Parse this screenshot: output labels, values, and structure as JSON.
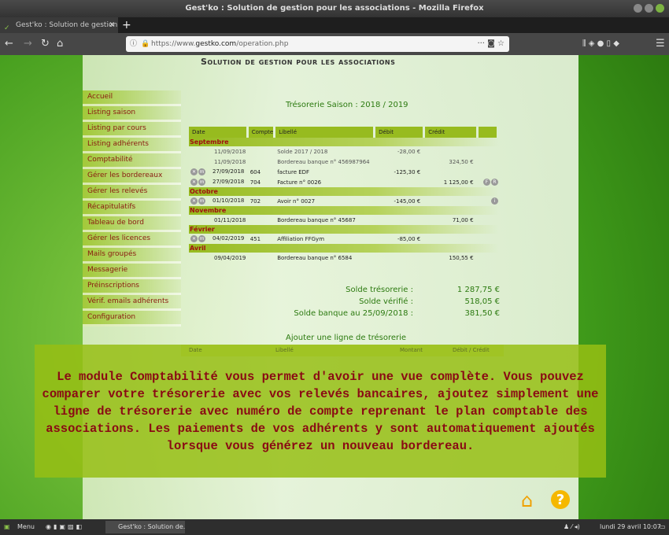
{
  "window": {
    "title": "Gest'ko : Solution de gestion pour les associations - Mozilla Firefox"
  },
  "browser": {
    "tab_title": "Gest'ko : Solution de gestion p",
    "url_prefix": "https://www.",
    "url_domain": "gestko.com",
    "url_path": "/operation.php"
  },
  "header": {
    "slogan": "Solution de gestion pour les associations"
  },
  "sidebar": {
    "items": [
      {
        "label": "Accueil"
      },
      {
        "label": "Listing saison"
      },
      {
        "label": "Listing par cours"
      },
      {
        "label": "Listing adhérents"
      },
      {
        "label": "Comptabilité"
      },
      {
        "label": "Gérer les bordereaux"
      },
      {
        "label": "Gérer les relevés"
      },
      {
        "label": "Récapitulatifs"
      },
      {
        "label": "Tableau de bord"
      },
      {
        "label": "Gérer les licences"
      },
      {
        "label": "Mails groupés"
      },
      {
        "label": "Messagerie"
      },
      {
        "label": "Préinscriptions"
      },
      {
        "label": "Vérif. emails adhérents"
      },
      {
        "label": "Configuration"
      }
    ]
  },
  "main": {
    "title": "Trésorerie Saison : 2018 / 2019",
    "columns": [
      "Date",
      "Compte",
      "Libellé",
      "Débit",
      "Crédit",
      ""
    ],
    "groups": [
      {
        "month": "Septembre",
        "rows": [
          {
            "date": "11/09/2018",
            "compte": "",
            "libelle": "Solde 2017 / 2018",
            "debit": "-28,00 €",
            "credit": "",
            "editable": false,
            "muted": true,
            "tags": []
          },
          {
            "date": "11/09/2018",
            "compte": "",
            "libelle": "Bordereau banque n° 456987964",
            "debit": "",
            "credit": "324,50 €",
            "editable": false,
            "muted": true,
            "tags": []
          },
          {
            "date": "27/09/2018",
            "compte": "604",
            "libelle": "facture EDF",
            "debit": "-125,30 €",
            "credit": "",
            "editable": true,
            "tags": []
          },
          {
            "date": "27/09/2018",
            "compte": "704",
            "libelle": "Facture n° 0026",
            "debit": "",
            "credit": "1 125,00 €",
            "editable": true,
            "tags": [
              "F",
              "R"
            ]
          }
        ]
      },
      {
        "month": "Octobre",
        "rows": [
          {
            "date": "01/10/2018",
            "compte": "702",
            "libelle": "Avoir n° 0027",
            "debit": "-145,00 €",
            "credit": "",
            "editable": true,
            "tags": [
              "i"
            ]
          }
        ]
      },
      {
        "month": "Novembre",
        "rows": [
          {
            "date": "01/11/2018",
            "compte": "",
            "libelle": "Bordereau banque n° 45687",
            "debit": "",
            "credit": "71,00 €",
            "editable": false,
            "tags": []
          }
        ]
      },
      {
        "month": "Février",
        "rows": [
          {
            "date": "04/02/2019",
            "compte": "451",
            "libelle": "Affiliation FFGym",
            "debit": "-85,00 €",
            "credit": "",
            "editable": true,
            "tags": []
          }
        ]
      },
      {
        "month": "Avril",
        "rows": [
          {
            "date": "09/04/2019",
            "compte": "",
            "libelle": "Bordereau banque n° 6584",
            "debit": "",
            "credit": "150,55 €",
            "editable": false,
            "tags": []
          }
        ]
      }
    ],
    "summary": [
      {
        "label": "Solde trésorerie :",
        "value": "1 287,75 €"
      },
      {
        "label": "Solde vérifié :",
        "value": "518,05 €"
      },
      {
        "label": "Solde banque au 25/09/2018 :",
        "value": "381,50 €"
      }
    ],
    "add_title": "Ajouter une ligne de trésorerie",
    "add_columns": [
      "Date",
      "Libellé",
      "Montant",
      "Débit / Crédit"
    ]
  },
  "overlay": {
    "text": "Le module Comptabilité vous permet d'avoir une vue complète. Vous pouvez comparer votre trésorerie avec vos relevés bancaires, ajoutez simplement une ligne de trésorerie avec numéro de compte reprenant le plan comptable des associations. Les paiements de vos adhérents y sont automatiquement ajoutés lorsque vous générez un nouveau bordereau."
  },
  "taskbar": {
    "menu": "Menu",
    "window": "Gest'ko : Solution de...",
    "clock": "lundi 29 avril  10:07"
  },
  "colors": {
    "accent": "#97bb1f",
    "link": "#8a1a10",
    "title": "#2c7a10",
    "overlay_text": "#8a0a14"
  }
}
